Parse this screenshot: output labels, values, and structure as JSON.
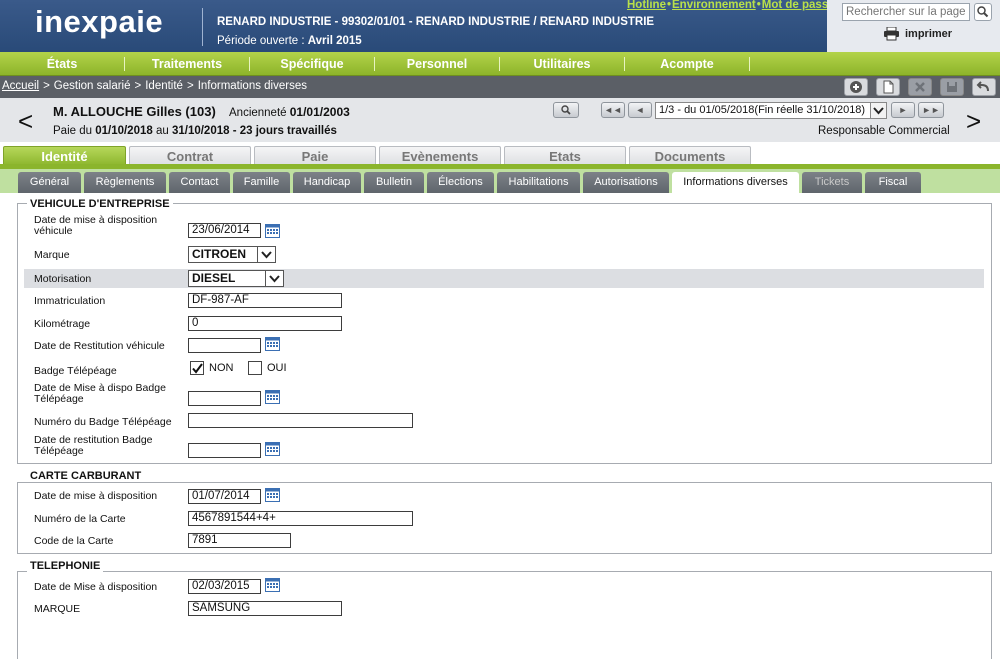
{
  "header": {
    "logo": "inexpaie",
    "company": "RENARD INDUSTRIE - 99302/01/01 - RENARD INDUSTRIE / RENARD INDUSTRIE",
    "period_label": "Période ouverte : ",
    "period_value": "Avril 2015",
    "links": [
      "Hotline",
      "Environnement",
      "Mot de passe"
    ],
    "search_placeholder": "Rechercher sur la page...",
    "print_label": "imprimer"
  },
  "main_menu": [
    "États",
    "Traitements",
    "Spécifique",
    "Personnel",
    "Utilitaires",
    "Acompte"
  ],
  "breadcrumb": [
    "Accueil",
    "Gestion salarié",
    "Identité",
    "Informations diverses"
  ],
  "employee": {
    "name": "M. ALLOUCHE  Gilles  (103)",
    "anciennete_label": "Ancienneté ",
    "anciennete_value": "01/01/2003",
    "pay_prefix": "Paie du ",
    "pay_from": "01/10/2018",
    "pay_mid": " au ",
    "pay_to": "31/10/2018",
    "pay_suffix": " - 23 jours travaillés",
    "period_select": "1/3 - du 01/05/2018(Fin réelle 31/10/2018)",
    "role": "Responsable Commercial",
    "first_btn": "◄◄",
    "prev_btn": "◄",
    "next_btn": "►",
    "last_btn": "►►"
  },
  "main_tabs": [
    "Identité",
    "Contrat",
    "Paie",
    "Evènements",
    "Etats",
    "Documents"
  ],
  "sub_tabs": [
    "Général",
    "Règlements",
    "Contact",
    "Famille",
    "Handicap",
    "Bulletin",
    "Élections",
    "Habilitations",
    "Autorisations",
    "Informations diverses",
    "Tickets",
    "Fiscal"
  ],
  "vehicule": {
    "title": "VEHICULE D'ENTREPRISE",
    "date_dispo_label": "Date de mise à disposition véhicule",
    "date_dispo_value": "23/06/2014",
    "marque_label": "Marque",
    "marque_value": "CITROEN",
    "motorisation_label": "Motorisation",
    "motorisation_value": "DIESEL",
    "immat_label": "Immatriculation",
    "immat_value": "DF-987-AF",
    "km_label": "Kilométrage",
    "km_value": "0",
    "restit_label": "Date de Restitution véhicule",
    "badge_label": "Badge Télépéage",
    "badge_non": "NON",
    "badge_oui": "OUI",
    "badge_dispo_label": "Date de Mise à dispo Badge Télépéage",
    "badge_num_label": "Numéro du Badge Télépéage",
    "badge_restit_label": "Date de restitution Badge Télépéage"
  },
  "carburant": {
    "title": "CARTE CARBURANT",
    "date_label": "Date de mise à disposition",
    "date_value": "01/07/2014",
    "num_label": "Numéro de la Carte",
    "num_value": "4567891544+4+",
    "code_label": "Code de la Carte",
    "code_value": "7891"
  },
  "telephonie": {
    "title": "TELEPHONIE",
    "date_label": "Date de Mise à disposition",
    "date_value": "02/03/2015",
    "marque_label": "MARQUE",
    "marque_value": "SAMSUNG"
  }
}
